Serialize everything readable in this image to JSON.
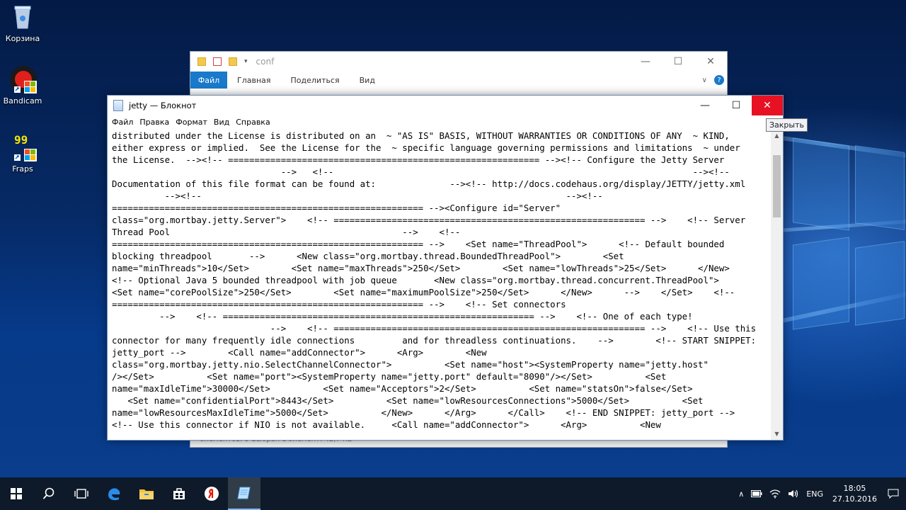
{
  "desktop": {
    "icons": [
      {
        "label": "Корзина",
        "icon": "recycle-bin-icon"
      },
      {
        "label": "Bandicam",
        "icon": "bandicam-icon"
      },
      {
        "label": "Fraps",
        "icon": "fraps-icon",
        "badge": "99"
      }
    ]
  },
  "explorer": {
    "title": "conf",
    "ribbon": {
      "file": "Файл",
      "tabs": [
        "Главная",
        "Поделиться",
        "Вид"
      ]
    },
    "status": "элементов: 9    Выбран 1 элемент: 42,7 КБ"
  },
  "notepad": {
    "title": "jetty — Блокнот",
    "menu": [
      "Файл",
      "Правка",
      "Формат",
      "Вид",
      "Справка"
    ],
    "lines": [
      "distributed under the License is distributed on an  ~ \"AS IS\" BASIS, WITHOUT WARRANTIES OR CONDITIONS OF ANY  ~ KIND,",
      "either express or implied.  See the License for the  ~ specific language governing permissions and limitations  ~ under",
      "the License.  --><!-- =========================================================== --><!-- Configure the Jetty Server",
      "                                -->   <!--                                                                    --><!--",
      "Documentation of this file format can be found at:              --><!-- http://docs.codehaus.org/display/JETTY/jetty.xml",
      "          --><!--                                                                     --><!--",
      "=========================================================== --><Configure id=\"Server\"",
      "class=\"org.mortbay.jetty.Server\">    <!-- =========================================================== -->    <!-- Server",
      "Thread Pool                                            -->    <!--",
      "=========================================================== -->    <Set name=\"ThreadPool\">      <!-- Default bounded",
      "blocking threadpool       -->      <New class=\"org.mortbay.thread.BoundedThreadPool\">        <Set",
      "name=\"minThreads\">10</Set>        <Set name=\"maxThreads\">250</Set>        <Set name=\"lowThreads\">25</Set>      </New>",
      "<!-- Optional Java 5 bounded threadpool with job queue       <New class=\"org.mortbay.thread.concurrent.ThreadPool\">",
      "<Set name=\"corePoolSize\">250</Set>        <Set name=\"maximumPoolSize\">250</Set>      </New>      -->    </Set>    <!--",
      "=========================================================== -->    <!-- Set connectors",
      "         -->    <!-- =========================================================== -->    <!-- One of each type!",
      "                              -->    <!-- =========================================================== -->    <!-- Use this",
      "connector for many frequently idle connections         and for threadless continuations.    -->        <!-- START SNIPPET:",
      "jetty_port -->        <Call name=\"addConnector\">      <Arg>        <New",
      "class=\"org.mortbay.jetty.nio.SelectChannelConnector\">          <Set name=\"host\"><SystemProperty name=\"jetty.host\"",
      "/></Set>          <Set name=\"port\"><SystemProperty name=\"jetty.port\" default=\"8090\"/></Set>          <Set",
      "name=\"maxIdleTime\">30000</Set>          <Set name=\"Acceptors\">2</Set>          <Set name=\"statsOn\">false</Set>",
      "   <Set name=\"confidentialPort\">8443</Set>          <Set name=\"lowResourcesConnections\">5000</Set>          <Set",
      "name=\"lowResourcesMaxIdleTime\">5000</Set>          </New>      </Arg>      </Call>    <!-- END SNIPPET: jetty_port -->",
      "<!-- Use this connector if NIO is not available.     <Call name=\"addConnector\">      <Arg>          <New"
    ]
  },
  "tooltip": "Закрыть",
  "taskbar": {
    "language": "ENG",
    "time": "18:05",
    "date": "27.10.2016"
  }
}
